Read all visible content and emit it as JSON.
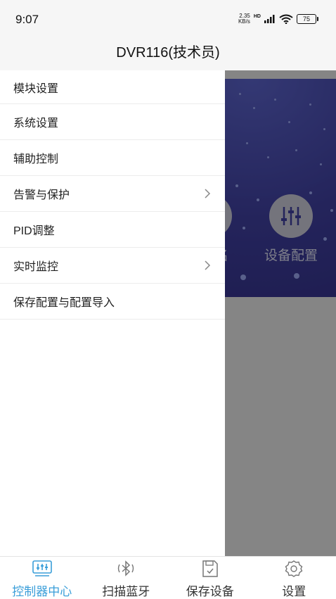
{
  "status": {
    "time": "9:07",
    "net_speed_top": "2.35",
    "net_speed_bottom": "KB/s",
    "hd": "HD",
    "battery": "75"
  },
  "header": {
    "title": "DVR116(技术员)"
  },
  "background": {
    "partial_label": "名",
    "device_config_label": "设备配置"
  },
  "drawer": {
    "items": [
      {
        "label": "模块设置",
        "has_arrow": false
      },
      {
        "label": "系统设置",
        "has_arrow": false
      },
      {
        "label": "辅助控制",
        "has_arrow": false
      },
      {
        "label": "告警与保护",
        "has_arrow": true
      },
      {
        "label": "PID调整",
        "has_arrow": false
      },
      {
        "label": "实时监控",
        "has_arrow": true
      },
      {
        "label": "保存配置与配置导入",
        "has_arrow": false
      }
    ]
  },
  "bottom_nav": {
    "items": [
      {
        "label": "控制器中心",
        "icon": "controller-center-icon",
        "active": true
      },
      {
        "label": "扫描蓝牙",
        "icon": "bluetooth-icon",
        "active": false
      },
      {
        "label": "保存设备",
        "icon": "save-device-icon",
        "active": false
      },
      {
        "label": "设置",
        "icon": "gear-icon",
        "active": false
      }
    ]
  },
  "colors": {
    "accent": "#3a9ed9",
    "banner": "#3f3f9e"
  }
}
